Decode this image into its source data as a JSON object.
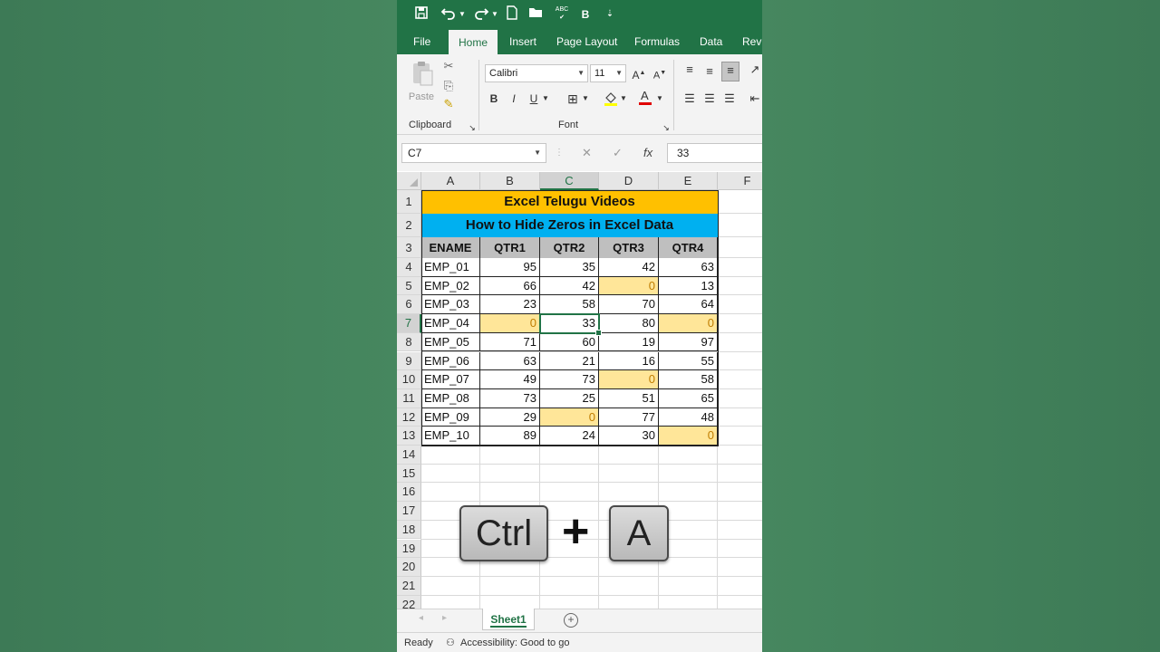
{
  "qat": {
    "icons": [
      "save-icon",
      "undo-icon",
      "redo-icon",
      "new-file-icon",
      "open-folder-icon",
      "spelling-icon",
      "bold-icon",
      "customize-icon"
    ],
    "bold_label": "B",
    "spell_label": "ABC"
  },
  "tabs": [
    "File",
    "Home",
    "Insert",
    "Page Layout",
    "Formulas",
    "Data",
    "Revi"
  ],
  "active_tab": "Home",
  "ribbon": {
    "paste_label": "Paste",
    "clipboard_label": "Clipboard",
    "font_group_label": "Font",
    "font_name": "Calibri",
    "font_size": "11",
    "bold": "B",
    "italic": "I",
    "underline": "U"
  },
  "formula_bar": {
    "name_box": "C7",
    "fx_label": "fx",
    "formula": "33"
  },
  "columns": [
    "A",
    "B",
    "C",
    "D",
    "E",
    "F"
  ],
  "selected_column": "C",
  "rows": [
    "1",
    "2",
    "3",
    "4",
    "5",
    "6",
    "7",
    "8",
    "9",
    "10",
    "11",
    "12",
    "13",
    "14",
    "15",
    "16",
    "17",
    "18",
    "19",
    "20",
    "21",
    "22"
  ],
  "selected_row": "7",
  "table": {
    "title": "Excel Telugu Videos",
    "subtitle": "How to Hide Zeros in Excel Data",
    "headers": [
      "ENAME",
      "QTR1",
      "QTR2",
      "QTR3",
      "QTR4"
    ],
    "data": [
      [
        "EMP_01",
        "95",
        "35",
        "42",
        "63"
      ],
      [
        "EMP_02",
        "66",
        "42",
        "0",
        "13"
      ],
      [
        "EMP_03",
        "23",
        "58",
        "70",
        "64"
      ],
      [
        "EMP_04",
        "0",
        "33",
        "80",
        "0"
      ],
      [
        "EMP_05",
        "71",
        "60",
        "19",
        "97"
      ],
      [
        "EMP_06",
        "63",
        "21",
        "16",
        "55"
      ],
      [
        "EMP_07",
        "49",
        "73",
        "0",
        "58"
      ],
      [
        "EMP_08",
        "73",
        "25",
        "51",
        "65"
      ],
      [
        "EMP_09",
        "29",
        "0",
        "77",
        "48"
      ],
      [
        "EMP_10",
        "89",
        "24",
        "30",
        "0"
      ]
    ],
    "highlight_color": "#ffe699"
  },
  "overlay": {
    "key1": "Ctrl",
    "plus": "+",
    "key2": "A"
  },
  "sheets": [
    "Sheet1"
  ],
  "status": {
    "ready": "Ready",
    "accessibility": "Accessibility: Good to go"
  },
  "colors": {
    "excel_green": "#217346",
    "title_fill": "#ffc000",
    "subtitle_fill": "#00b0f0",
    "header_fill": "#bfbfbf"
  }
}
